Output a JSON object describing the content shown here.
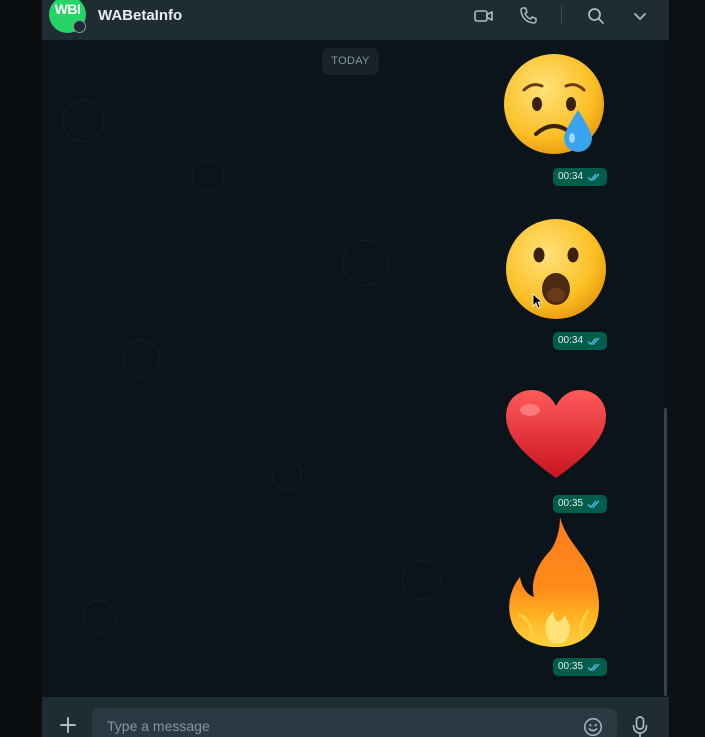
{
  "header": {
    "contact_name": "WABetaInfo",
    "avatar_text": "WBI",
    "icons": [
      "video-call-icon",
      "voice-call-icon",
      "search-icon",
      "chevron-down-icon"
    ]
  },
  "chat": {
    "day_label": "TODAY",
    "messages": [
      {
        "sticker": "sad-but-relieved-face",
        "time": "00:34",
        "status": "read"
      },
      {
        "sticker": "face-with-open-mouth",
        "time": "00:34",
        "status": "read"
      },
      {
        "sticker": "red-heart",
        "time": "00:35",
        "status": "read"
      },
      {
        "sticker": "fire",
        "time": "00:35",
        "status": "read"
      }
    ]
  },
  "composer": {
    "placeholder": "Type a message",
    "icons": [
      "attach-plus-icon",
      "emoji-icon",
      "mic-icon"
    ]
  },
  "colors": {
    "header_bg": "#1f2c33",
    "chat_bg": "#0b141a",
    "outgoing_bubble": "#005c4b",
    "read_tick": "#53bdeb",
    "avatar_green": "#25d366"
  }
}
